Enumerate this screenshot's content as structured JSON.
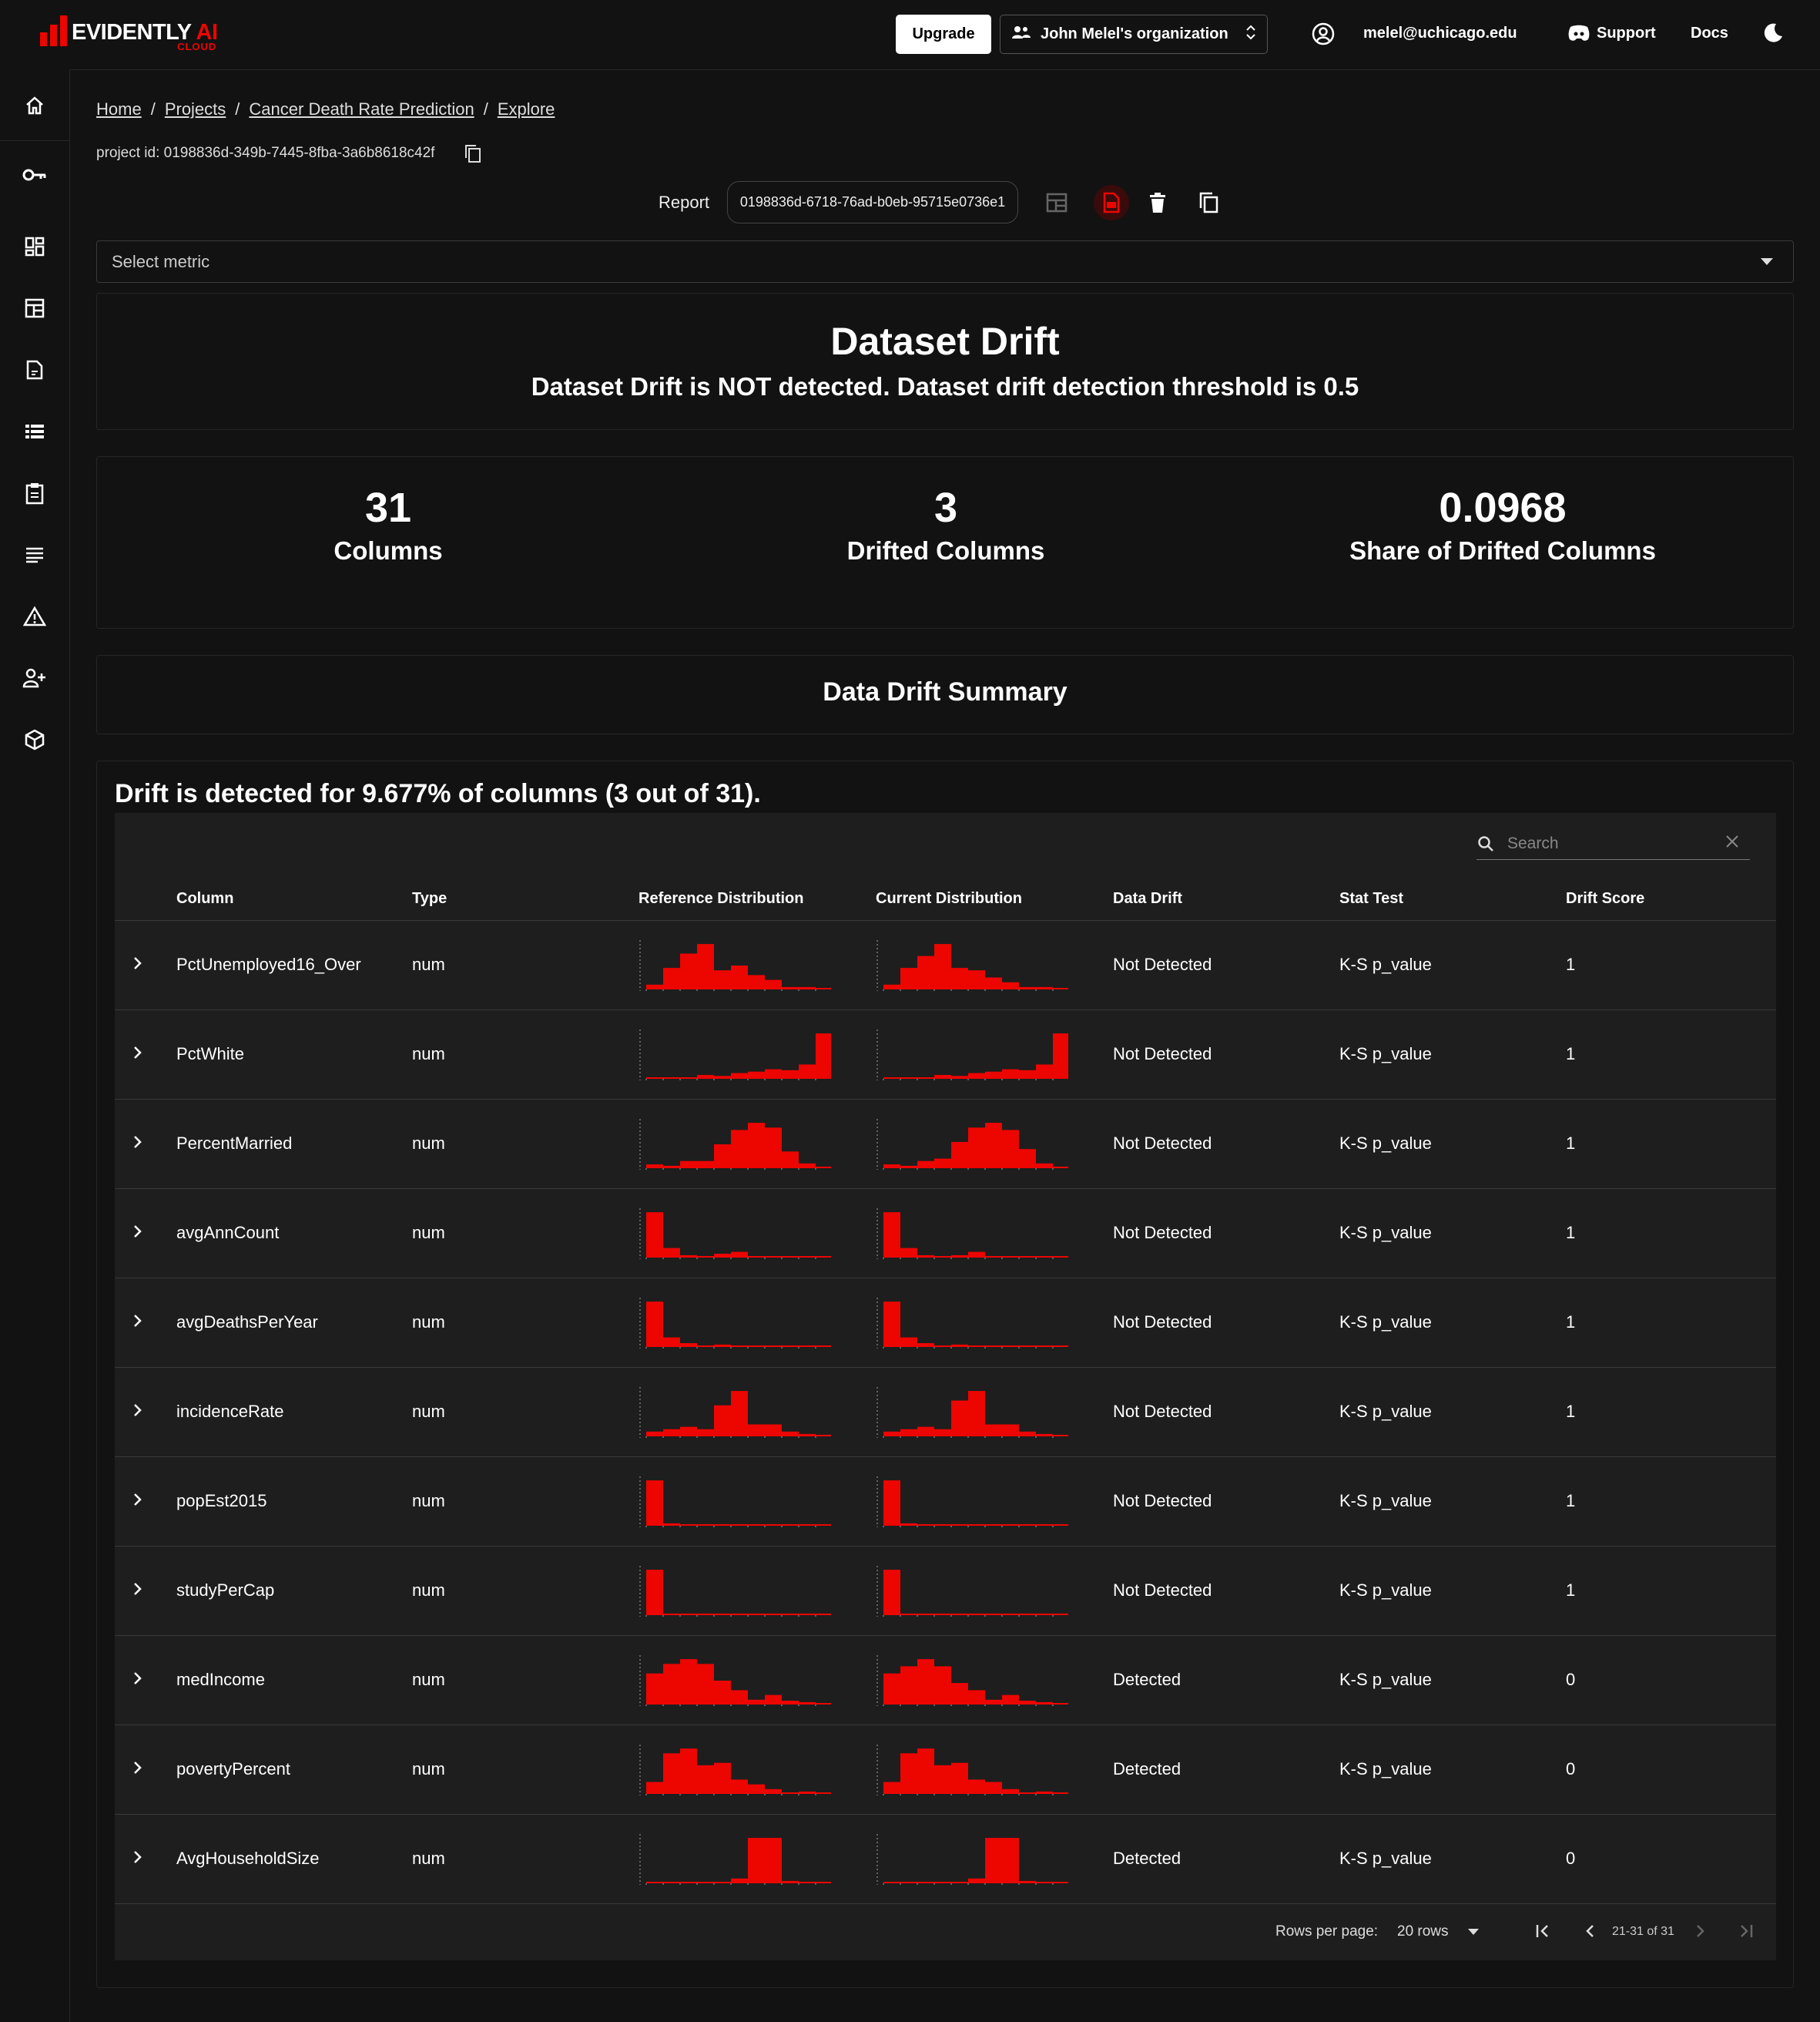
{
  "app": {
    "logo_text": "EVIDENTLY",
    "logo_ai": " AI",
    "logo_cloud": "CLOUD"
  },
  "header": {
    "upgrade_label": "Upgrade",
    "org_label": "John Melel's organization",
    "user_email": "melel@uchicago.edu",
    "support_label": "Support",
    "docs_label": "Docs"
  },
  "sidebar": {
    "items": [
      "home-icon",
      "key-icon",
      "dashboard-icon",
      "report-icon",
      "document-icon",
      "list-icon",
      "clipboard-icon",
      "lines-icon",
      "alert-icon",
      "user-add-icon",
      "package-icon"
    ]
  },
  "breadcrumb": {
    "items": [
      "Home",
      "Projects",
      "Cancer Death Rate Prediction",
      "Explore"
    ],
    "separator": "/"
  },
  "project": {
    "id_text": "project id: 0198836d-349b-7445-8fba-3a6b8618c42f"
  },
  "report": {
    "label": "Report",
    "id": "0198836d-6718-76ad-b0eb-95715e0736e1"
  },
  "select_metric": {
    "placeholder": "Select metric"
  },
  "dataset_drift": {
    "title": "Dataset Drift",
    "subtitle": "Dataset Drift is NOT detected. Dataset drift detection threshold is 0.5"
  },
  "stats": [
    {
      "value": "31",
      "label": "Columns"
    },
    {
      "value": "3",
      "label": "Drifted Columns"
    },
    {
      "value": "0.0968",
      "label": "Share of Drifted Columns"
    }
  ],
  "summary_title": "Data Drift Summary",
  "table": {
    "heading": "Drift is detected for 9.677% of columns (3 out of 31).",
    "search_placeholder": "Search",
    "columns": [
      "Column",
      "Type",
      "Reference Distribution",
      "Current Distribution",
      "Data Drift",
      "Stat Test",
      "Drift Score"
    ],
    "rows": [
      {
        "column": "PctUnemployed16_Over",
        "type": "num",
        "drift": "Not Detected",
        "test": "K-S p_value",
        "score": "1",
        "ref": [
          0.1,
          0.45,
          0.75,
          0.95,
          0.4,
          0.5,
          0.3,
          0.2,
          0.05,
          0.05,
          0.02
        ],
        "cur": [
          0.1,
          0.45,
          0.7,
          0.95,
          0.45,
          0.4,
          0.25,
          0.15,
          0.05,
          0.05,
          0.02
        ]
      },
      {
        "column": "PctWhite",
        "type": "num",
        "drift": "Not Detected",
        "test": "K-S p_value",
        "score": "1",
        "ref": [
          0.02,
          0.02,
          0.03,
          0.08,
          0.06,
          0.12,
          0.15,
          0.2,
          0.18,
          0.3,
          0.95
        ],
        "cur": [
          0.02,
          0.02,
          0.03,
          0.08,
          0.06,
          0.12,
          0.15,
          0.2,
          0.18,
          0.3,
          0.95
        ]
      },
      {
        "column": "PercentMarried",
        "type": "num",
        "drift": "Not Detected",
        "test": "K-S p_value",
        "score": "1",
        "ref": [
          0.08,
          0.05,
          0.15,
          0.15,
          0.5,
          0.8,
          0.95,
          0.85,
          0.35,
          0.1,
          0.02
        ],
        "cur": [
          0.08,
          0.05,
          0.15,
          0.2,
          0.55,
          0.85,
          0.95,
          0.8,
          0.4,
          0.1,
          0.02
        ]
      },
      {
        "column": "avgAnnCount",
        "type": "num",
        "drift": "Not Detected",
        "test": "K-S p_value",
        "score": "1",
        "ref": [
          0.95,
          0.2,
          0.05,
          0.03,
          0.08,
          0.12,
          0.03,
          0.01,
          0.02,
          0.01,
          0.01
        ],
        "cur": [
          0.95,
          0.2,
          0.05,
          0.03,
          0.05,
          0.12,
          0.03,
          0.01,
          0.02,
          0.01,
          0.01
        ]
      },
      {
        "column": "avgDeathsPerYear",
        "type": "num",
        "drift": "Not Detected",
        "test": "K-S p_value",
        "score": "1",
        "ref": [
          0.95,
          0.2,
          0.08,
          0.02,
          0.05,
          0.03,
          0.01,
          0.01,
          0.01,
          0.01,
          0.01
        ],
        "cur": [
          0.95,
          0.2,
          0.08,
          0.02,
          0.05,
          0.03,
          0.01,
          0.01,
          0.01,
          0.01,
          0.01
        ]
      },
      {
        "column": "incidenceRate",
        "type": "num",
        "drift": "Not Detected",
        "test": "K-S p_value",
        "score": "1",
        "ref": [
          0.1,
          0.15,
          0.2,
          0.15,
          0.65,
          0.95,
          0.25,
          0.25,
          0.1,
          0.05,
          0.02
        ],
        "cur": [
          0.1,
          0.15,
          0.2,
          0.15,
          0.75,
          0.95,
          0.25,
          0.25,
          0.1,
          0.05,
          0.02
        ]
      },
      {
        "column": "popEst2015",
        "type": "num",
        "drift": "Not Detected",
        "test": "K-S p_value",
        "score": "1",
        "ref": [
          0.95,
          0.05,
          0.02,
          0.01,
          0.01,
          0.01,
          0.01,
          0.01,
          0.01,
          0.01,
          0.01
        ],
        "cur": [
          0.95,
          0.05,
          0.02,
          0.01,
          0.01,
          0.01,
          0.01,
          0.01,
          0.01,
          0.01,
          0.01
        ]
      },
      {
        "column": "studyPerCap",
        "type": "num",
        "drift": "Not Detected",
        "test": "K-S p_value",
        "score": "1",
        "ref": [
          0.95,
          0.03,
          0.01,
          0.01,
          0.01,
          0.01,
          0.01,
          0.01,
          0.01,
          0.01,
          0.01
        ],
        "cur": [
          0.95,
          0.03,
          0.01,
          0.01,
          0.01,
          0.01,
          0.01,
          0.01,
          0.01,
          0.01,
          0.01
        ]
      },
      {
        "column": "medIncome",
        "type": "num",
        "drift": "Detected",
        "test": "K-S p_value",
        "score": "0",
        "ref": [
          0.65,
          0.85,
          0.95,
          0.85,
          0.5,
          0.3,
          0.1,
          0.2,
          0.08,
          0.05,
          0.02
        ],
        "cur": [
          0.65,
          0.8,
          0.95,
          0.8,
          0.45,
          0.3,
          0.1,
          0.2,
          0.08,
          0.05,
          0.02
        ]
      },
      {
        "column": "povertyPercent",
        "type": "num",
        "drift": "Detected",
        "test": "K-S p_value",
        "score": "0",
        "ref": [
          0.25,
          0.85,
          0.95,
          0.6,
          0.65,
          0.3,
          0.2,
          0.1,
          0.01,
          0.05,
          0.01
        ],
        "cur": [
          0.25,
          0.85,
          0.95,
          0.6,
          0.65,
          0.3,
          0.25,
          0.1,
          0.01,
          0.05,
          0.01
        ]
      },
      {
        "column": "AvgHouseholdSize",
        "type": "num",
        "drift": "Detected",
        "test": "K-S p_value",
        "score": "0",
        "ref": [
          0.03,
          0.01,
          0.01,
          0.01,
          0.01,
          0.1,
          0.95,
          0.95,
          0.05,
          0.02,
          0.01
        ],
        "cur": [
          0.03,
          0.01,
          0.01,
          0.01,
          0.01,
          0.1,
          0.95,
          0.95,
          0.05,
          0.02,
          0.01
        ]
      }
    ]
  },
  "pagination": {
    "rows_per_page_label": "Rows per page:",
    "rows_value": "20 rows",
    "range": "21-31 of 31"
  },
  "colors": {
    "accent": "#ed0500",
    "background": "#121212",
    "table_bg": "#1e1e1e"
  }
}
